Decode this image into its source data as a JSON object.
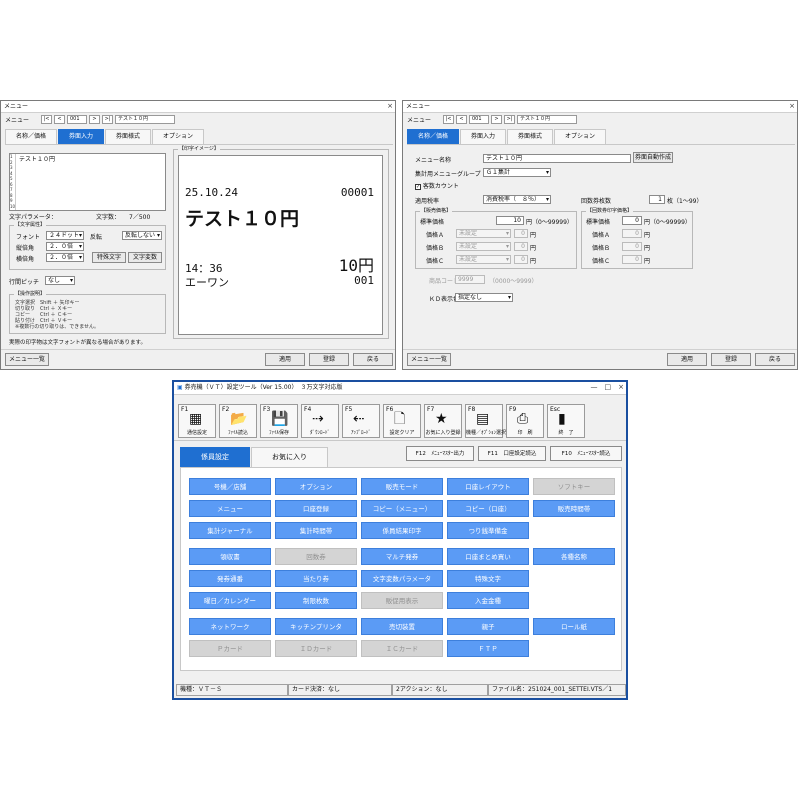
{
  "left_window": {
    "title": "メニュー",
    "menu_label": "メニュー",
    "nav": {
      "first": "|<",
      "prev": "<",
      "number": "001",
      "next": ">",
      "last": ">|",
      "name": "テスト１０円"
    },
    "tabs": [
      "名称／価格",
      "券面入力",
      "券面様式",
      "オプション"
    ],
    "list_title": "テスト１０円",
    "line_numbers": [
      "1",
      "2",
      "3",
      "4",
      "5",
      "6",
      "7",
      "8",
      "9",
      "10"
    ],
    "char_param_label": "文字パラメータ：",
    "char_count_label": "文字数：",
    "char_count_value": "7／500",
    "char_attr_group": "【文字属性】",
    "font_label": "フォント",
    "font_value": "２４ドット",
    "invert_label": "反転",
    "invert_value": "反転しない",
    "vertical_label": "縦倍角",
    "vertical_value": "２．０倍",
    "horizontal_label": "横倍角",
    "horizontal_value": "２．０倍",
    "special_char_button": "特殊文字",
    "char_var_button": "文字変数",
    "line_pitch_label": "行間ピッチ",
    "line_pitch_value": "なし",
    "help_group": "【操作説明】",
    "help_lines": [
      "文字選択　Shift ＋ 矢印キー",
      "切り取り　Ctrl ＋ Ｘキー",
      "コピー　　Ctrl ＋ Ｃキー",
      "貼り付け　Ctrl ＋ Ｖキー",
      "※複数行の切り取りは、できません。"
    ],
    "note": "実際の印字物は文字フォントが異なる場合があります。",
    "preview_group": "【印字イメージ】",
    "preview": {
      "date": "25.10.24",
      "serial": "00001",
      "title": "テスト１０円",
      "time": "14：36",
      "price": "10円",
      "staff": "エーワン",
      "code": "001"
    },
    "list_button": "メニュー一覧",
    "apply_button": "適用",
    "register_button": "登録",
    "back_button": "戻る"
  },
  "right_window": {
    "title": "メニュー",
    "menu_label": "メニュー",
    "nav": {
      "first": "|<",
      "prev": "<",
      "number": "001",
      "next": ">",
      "last": ">|",
      "name": "テスト１０円"
    },
    "tabs": [
      "名称／価格",
      "券面入力",
      "券面様式",
      "オプション"
    ],
    "menu_name_label": "メニュー名称",
    "menu_name_value": "テスト１０円",
    "auto_create_button": "券面自動作成",
    "group_label": "集計用メニューグループ",
    "group_value": "Ｇ１集計",
    "sales_count_label": "客数カウント",
    "tax_label": "適用税率",
    "tax_value": "消費税率（　８％）",
    "repeat_label": "回数券枚数",
    "repeat_value": "1",
    "repeat_unit": "枚（1～99）",
    "price_group": "【販売価格】",
    "std_price_label": "標準価格",
    "std_price_value": "10",
    "price_range": "円（0～99999）",
    "price_a_label": "価格Ａ",
    "price_b_label": "価格Ｂ",
    "price_c_label": "価格Ｃ",
    "price_setting": "未設定",
    "price_zero": "0",
    "yen": "円",
    "print_price_group": "【回数券印字価格】",
    "product_code_label": "商品コード",
    "product_code_value": "9999",
    "product_code_range": "（0000～9999）",
    "kd_label": "ＫＤ表示色",
    "kd_value": "指定なし",
    "list_button": "メニュー一覧",
    "apply_button": "適用",
    "register_button": "登録",
    "back_button": "戻る"
  },
  "main_window": {
    "title": "券売機（ＶＴ）設定ツール（Ver 15.00）　３万文字対応版",
    "toolbar": [
      {
        "key": "F1",
        "label": "通信設定",
        "icon": "terminal-icon",
        "glyph": "▦"
      },
      {
        "key": "F2",
        "label": "ﾌｧｲﾙ読込",
        "icon": "folder-icon",
        "glyph": "📂"
      },
      {
        "key": "F3",
        "label": "ﾌｧｲﾙ保存",
        "icon": "save-icon",
        "glyph": "💾"
      },
      {
        "key": "F4",
        "label": "ﾀﾞｳﾝﾛｰﾄﾞ",
        "icon": "download-icon",
        "glyph": "⇢"
      },
      {
        "key": "F5",
        "label": "ｱｯﾌﾟﾛｰﾄﾞ",
        "icon": "upload-icon",
        "glyph": "⇠"
      },
      {
        "key": "F6",
        "label": "設定クリア",
        "icon": "clear-icon",
        "glyph": "🗋"
      },
      {
        "key": "F7",
        "label": "お気に入り登録",
        "icon": "favorite-icon",
        "glyph": "★"
      },
      {
        "key": "F8",
        "label": "機種／ｵﾌﾟｼｮﾝ選択",
        "icon": "machine-icon",
        "glyph": "▤"
      },
      {
        "key": "F9",
        "label": "印　刷",
        "icon": "printer-icon",
        "glyph": "⎙"
      },
      {
        "key": "Esc",
        "label": "終　了",
        "icon": "exit-icon",
        "glyph": "▮"
      }
    ],
    "tabs": [
      "係員設定",
      "お気に入り"
    ],
    "fn_buttons": [
      "F12　ﾒﾆｭｰﾏｽﾀｰ出力",
      "F11　口座設定読込",
      "F10　ﾒﾆｭｰﾏｽﾀｰ読込"
    ],
    "grid": [
      [
        {
          "t": "号機／店舗"
        },
        {
          "t": "オプション"
        },
        {
          "t": "販売モード"
        },
        {
          "t": "口座レイアウト"
        },
        {
          "t": "ソフトキー",
          "d": true
        }
      ],
      [
        {
          "t": "メニュー"
        },
        {
          "t": "口座登録"
        },
        {
          "t": "コピー（メニュー）"
        },
        {
          "t": "コピー（口座）"
        },
        {
          "t": "販売時間帯"
        }
      ],
      [
        {
          "t": "集計ジャーナル"
        },
        {
          "t": "集計時間帯"
        },
        {
          "t": "係員結果印字"
        },
        {
          "t": "つり銭準備金"
        },
        null
      ],
      [
        {
          "t": "領収書"
        },
        {
          "t": "回数券",
          "d": true
        },
        {
          "t": "マルチ発券"
        },
        {
          "t": "口座まとめ買い"
        },
        {
          "t": "各種名称"
        }
      ],
      [
        {
          "t": "発券通番"
        },
        {
          "t": "当たり券"
        },
        {
          "t": "文字変数パラメータ"
        },
        {
          "t": "特殊文字"
        },
        null
      ],
      [
        {
          "t": "曜日／カレンダー"
        },
        {
          "t": "制限枚数"
        },
        {
          "t": "販促用表示",
          "d": true
        },
        {
          "t": "入金金種"
        },
        null
      ],
      [
        {
          "t": "ネットワーク"
        },
        {
          "t": "キッチンプリンタ"
        },
        {
          "t": "売切装置"
        },
        {
          "t": "親子"
        },
        {
          "t": "ロール紙"
        }
      ],
      [
        {
          "t": "Ｐカード",
          "d": true
        },
        {
          "t": "ＩＤカード",
          "d": true
        },
        {
          "t": "ＩＣカード",
          "d": true
        },
        {
          "t": "ＦＴＰ"
        },
        null
      ]
    ],
    "status": [
      "機種：ＶＴ－Ｓ",
      "カード決済：なし",
      "2アクション：なし",
      "ファイル名：251024_001_SETTEI.VTS／1"
    ]
  }
}
